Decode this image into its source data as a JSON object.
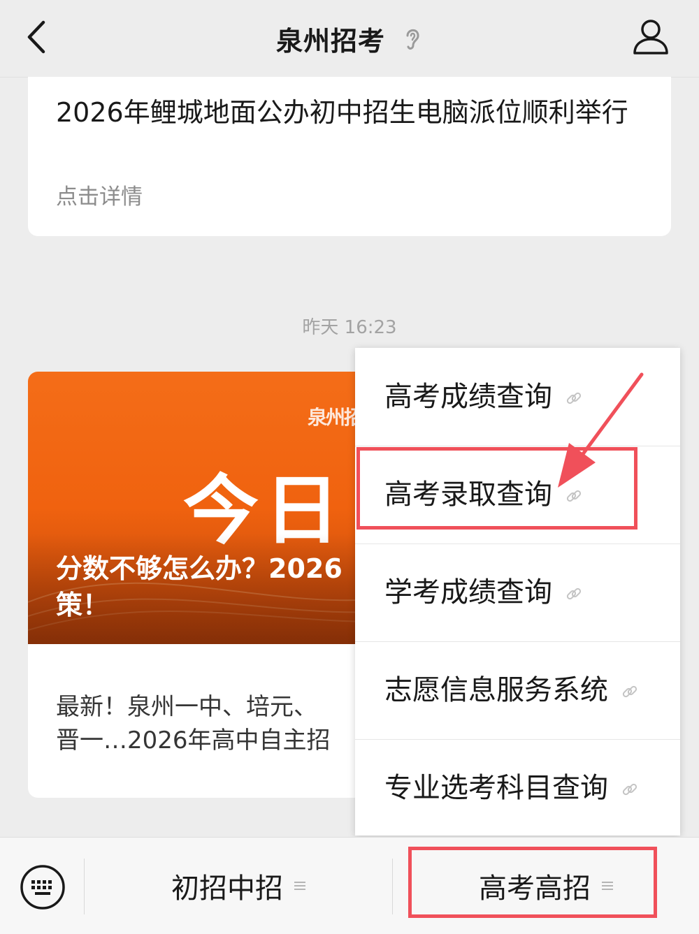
{
  "header": {
    "title": "泉州招考",
    "back_icon": "chevron-left-icon",
    "profile_icon": "person-icon",
    "ear_icon": "ear-icon"
  },
  "article_card": {
    "title": "2026年鲤城地面公办初中招生电脑派位顺利举行",
    "link_text": "点击详情"
  },
  "timestamp": "昨天 16:23",
  "news_card": {
    "banner_logo": "泉州招",
    "banner_big_text": "今日",
    "banner_caption": "分数不够怎么办？2026\n策！",
    "description": "最新！泉州一中、培元、\n晋一…2026年高中自主招"
  },
  "popup_menu": {
    "items": [
      {
        "label": "高考成绩查询"
      },
      {
        "label": "高考录取查询"
      },
      {
        "label": "学考成绩查询"
      },
      {
        "label": "志愿信息服务系统"
      },
      {
        "label": "专业选考科目查询"
      }
    ],
    "highlighted_index": 1
  },
  "bottom_menu": {
    "keyboard_icon": "keyboard-icon",
    "tabs": [
      {
        "label": "初招中招"
      },
      {
        "label": "高考高招"
      }
    ],
    "highlighted_index": 1
  },
  "colors": {
    "background": "#ededed",
    "highlight": "#f0505a",
    "banner_orange": "#f46d18"
  }
}
